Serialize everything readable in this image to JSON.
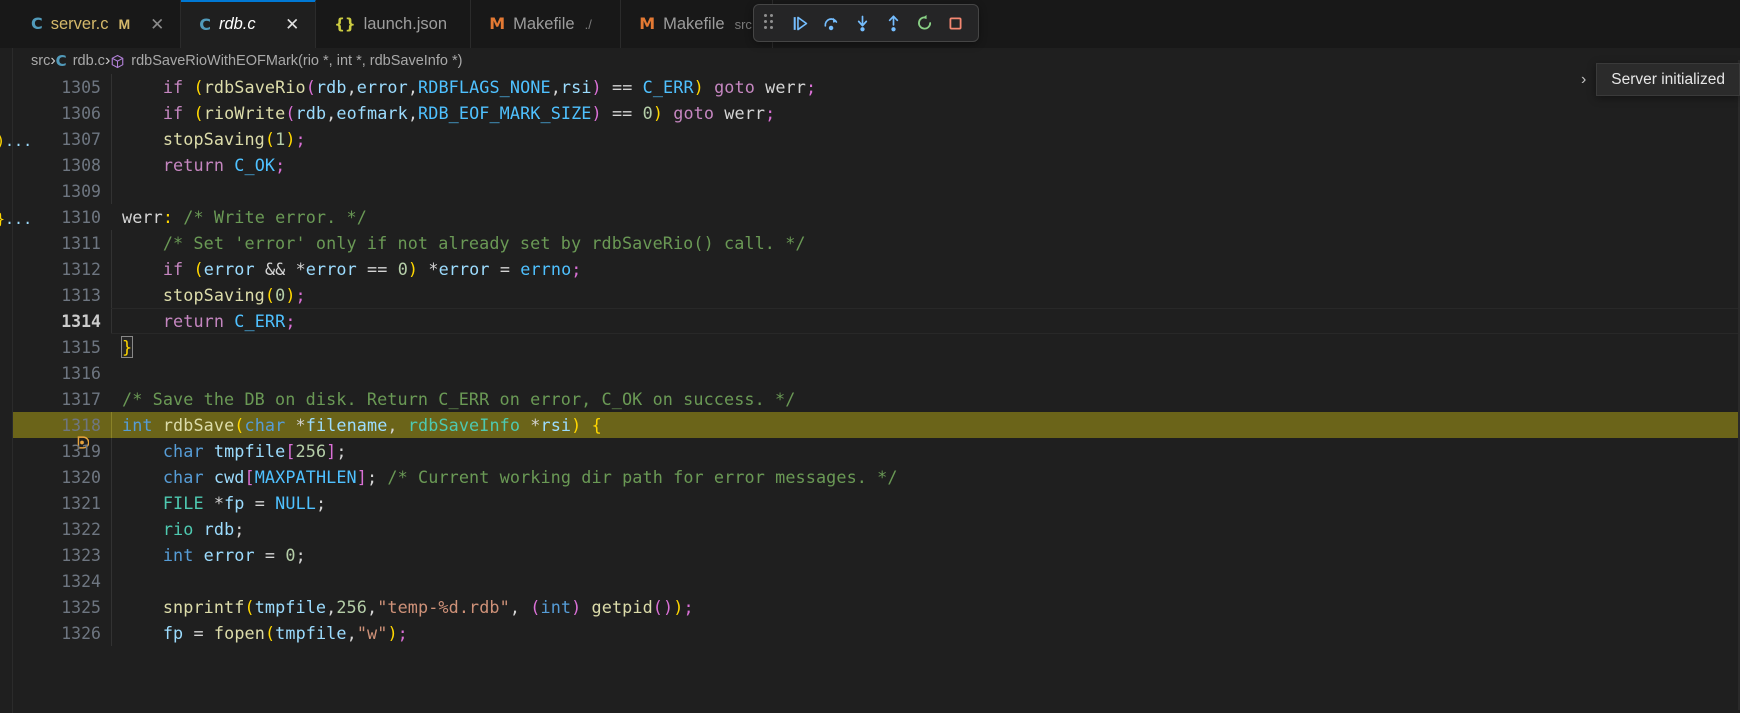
{
  "window": {
    "theme_bg": "#1e1e1e",
    "accent": "#0078d4"
  },
  "tabs": [
    {
      "icon": "c-file-icon",
      "label": "server.c",
      "dirty": "M",
      "desc": "",
      "active": false,
      "modified": true,
      "close": "✕"
    },
    {
      "icon": "c-file-icon",
      "label": "rdb.c",
      "dirty": "",
      "desc": "",
      "active": true,
      "modified": false,
      "close": "✕"
    },
    {
      "icon": "json-file-icon",
      "label": "launch.json",
      "dirty": "",
      "desc": "",
      "active": false,
      "modified": false,
      "close": ""
    },
    {
      "icon": "makefile-icon",
      "label": "Makefile",
      "dirty": "",
      "desc": "./",
      "active": false,
      "modified": false,
      "close": ""
    },
    {
      "icon": "makefile-icon",
      "label": "Makefile",
      "dirty": "",
      "desc": "src",
      "active": false,
      "modified": false,
      "close": ""
    }
  ],
  "debug_toolbar": {
    "buttons": [
      {
        "name": "continue-button",
        "tooltip": "Continue",
        "color": "#75beff"
      },
      {
        "name": "step-over-button",
        "tooltip": "Step Over",
        "color": "#75beff"
      },
      {
        "name": "step-into-button",
        "tooltip": "Step Into",
        "color": "#75beff"
      },
      {
        "name": "step-out-button",
        "tooltip": "Step Out",
        "color": "#75beff"
      },
      {
        "name": "restart-button",
        "tooltip": "Restart",
        "color": "#89d185"
      },
      {
        "name": "stop-button",
        "tooltip": "Stop",
        "color": "#f48771"
      }
    ]
  },
  "breadcrumb": {
    "root": "src",
    "file": "rdb.c",
    "symbol": "rdbSaveRioWithEOFMark(rio *, int *, rdbSaveInfo *)",
    "separator": "›"
  },
  "peek_widget": {
    "chevron": "›",
    "message": "Server initialized"
  },
  "editor": {
    "language": "c",
    "first_line": 1305,
    "cursor_line": 1314,
    "execution_line": 1318,
    "lines": [
      {
        "n": 1305,
        "text": "    if (rdbSaveRio(rdb,error,RDBFLAGS_NONE,rsi) == C_ERR) goto werr;"
      },
      {
        "n": 1306,
        "text": "    if (rioWrite(rdb,eofmark,RDB_EOF_MARK_SIZE) == 0) goto werr;"
      },
      {
        "n": 1307,
        "text": "    stopSaving(1);"
      },
      {
        "n": 1308,
        "text": "    return C_OK;"
      },
      {
        "n": 1309,
        "text": ""
      },
      {
        "n": 1310,
        "text": "werr: /* Write error. */"
      },
      {
        "n": 1311,
        "text": "    /* Set 'error' only if not already set by rdbSaveRio() call. */"
      },
      {
        "n": 1312,
        "text": "    if (error && *error == 0) *error = errno;"
      },
      {
        "n": 1313,
        "text": "    stopSaving(0);"
      },
      {
        "n": 1314,
        "text": "    return C_ERR;"
      },
      {
        "n": 1315,
        "text": "}"
      },
      {
        "n": 1316,
        "text": ""
      },
      {
        "n": 1317,
        "text": "/* Save the DB on disk. Return C_ERR on error, C_OK on success. */"
      },
      {
        "n": 1318,
        "text": "int rdbSave(char *filename, rdbSaveInfo *rsi) {"
      },
      {
        "n": 1319,
        "text": "    char tmpfile[256];"
      },
      {
        "n": 1320,
        "text": "    char cwd[MAXPATHLEN]; /* Current working dir path for error messages. */"
      },
      {
        "n": 1321,
        "text": "    FILE *fp = NULL;"
      },
      {
        "n": 1322,
        "text": "    rio rdb;"
      },
      {
        "n": 1323,
        "text": "    int error = 0;"
      },
      {
        "n": 1324,
        "text": ""
      },
      {
        "n": 1325,
        "text": "    snprintf(tmpfile,256,\"temp-%d.rdb\", (int) getpid());"
      },
      {
        "n": 1326,
        "text": "    fp = fopen(tmpfile,\"w\");"
      }
    ]
  }
}
